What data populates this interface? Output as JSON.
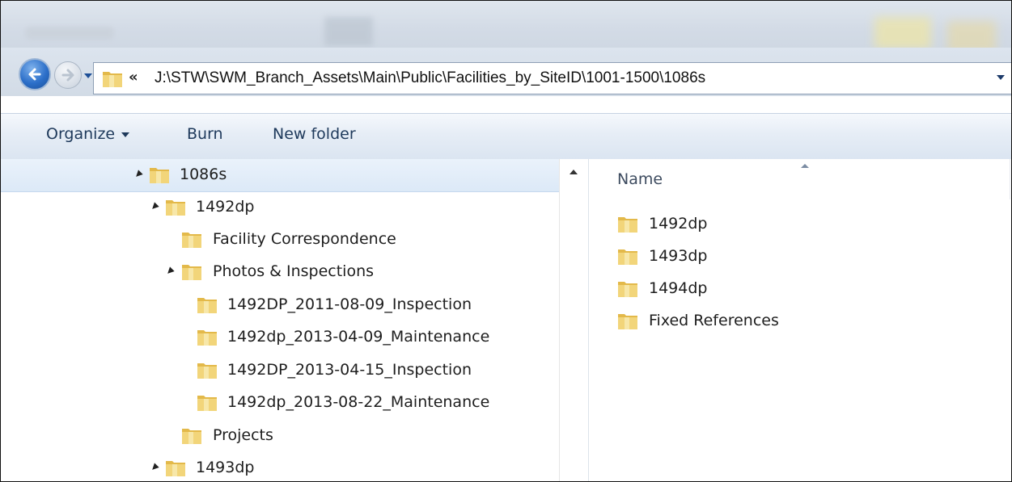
{
  "navigation": {
    "back_icon": "back-arrow-icon",
    "forward_icon": "forward-arrow-icon",
    "chevron": "«",
    "address_path": "J:\\STW\\SWM_Branch_Assets\\Main\\Public\\Facilities_by_SiteID\\1001-1500\\1086s"
  },
  "toolbar": {
    "organize_label": "Organize",
    "burn_label": "Burn",
    "new_folder_label": "New folder"
  },
  "tree": {
    "items": [
      {
        "label": "1086s",
        "expanded": true
      },
      {
        "label": "1492dp",
        "expanded": true
      },
      {
        "label": "Facility Correspondence",
        "expanded": false
      },
      {
        "label": "Photos & Inspections",
        "expanded": true
      },
      {
        "label": "1492DP_2011-08-09_Inspection",
        "expanded": false
      },
      {
        "label": "1492dp_2013-04-09_Maintenance",
        "expanded": false
      },
      {
        "label": "1492DP_2013-04-15_Inspection",
        "expanded": false
      },
      {
        "label": "1492dp_2013-08-22_Maintenance",
        "expanded": false
      },
      {
        "label": "Projects",
        "expanded": false
      },
      {
        "label": "1493dp",
        "expanded": true
      }
    ]
  },
  "content": {
    "column_name": "Name",
    "files": [
      {
        "label": "1492dp",
        "icon": "folder-icon"
      },
      {
        "label": "1493dp",
        "icon": "folder-icon"
      },
      {
        "label": "1494dp",
        "icon": "folder-icon"
      },
      {
        "label": "Fixed References",
        "icon": "folder-icon"
      }
    ]
  },
  "colors": {
    "folder": "#e8c45a",
    "selection": "#dce9f7",
    "toolbar_text": "#1e395b"
  }
}
